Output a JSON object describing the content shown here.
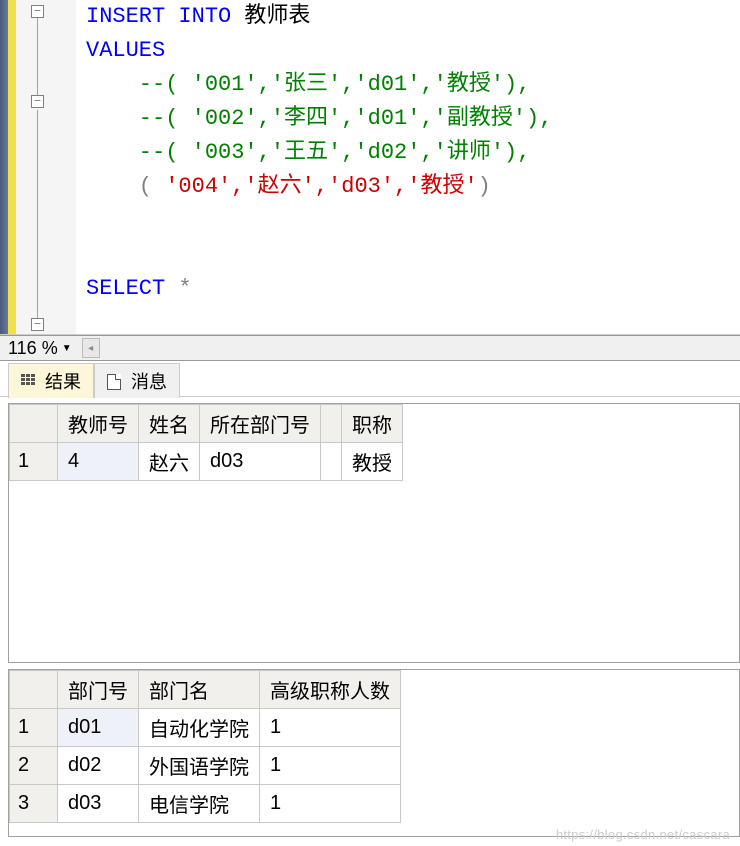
{
  "editor": {
    "line1_kw": "INSERT INTO",
    "line1_target": " 教师表",
    "line2_kw": "VALUES",
    "line3": "    --( '001','张三','d01','教授'),",
    "line4": "    --( '002','李四','d01','副教授'),",
    "line5": "    --( '003','王五','d02','讲师'),",
    "line6_open": "    ( ",
    "line6_val": "'004','赵六','d03','教授'",
    "line6_close": ")",
    "line7_kw": "SELECT",
    "line7_op": " *"
  },
  "zoom": {
    "value": "116 %"
  },
  "tabs": {
    "results": "结果",
    "messages": "消息"
  },
  "table1": {
    "headers": [
      "教师号",
      "姓名",
      "所在部门号",
      "职称"
    ],
    "rows": [
      {
        "n": "1",
        "cells": [
          "4",
          "赵六",
          "d03",
          "",
          "教授"
        ]
      }
    ]
  },
  "table2": {
    "headers": [
      "部门号",
      "部门名",
      "高级职称人数"
    ],
    "rows": [
      {
        "n": "1",
        "cells": [
          "d01",
          "自动化学院",
          "1"
        ]
      },
      {
        "n": "2",
        "cells": [
          "d02",
          "外国语学院",
          "1"
        ]
      },
      {
        "n": "3",
        "cells": [
          "d03",
          "电信学院",
          "1"
        ]
      }
    ]
  },
  "watermark": "https://blog.csdn.net/cascara"
}
